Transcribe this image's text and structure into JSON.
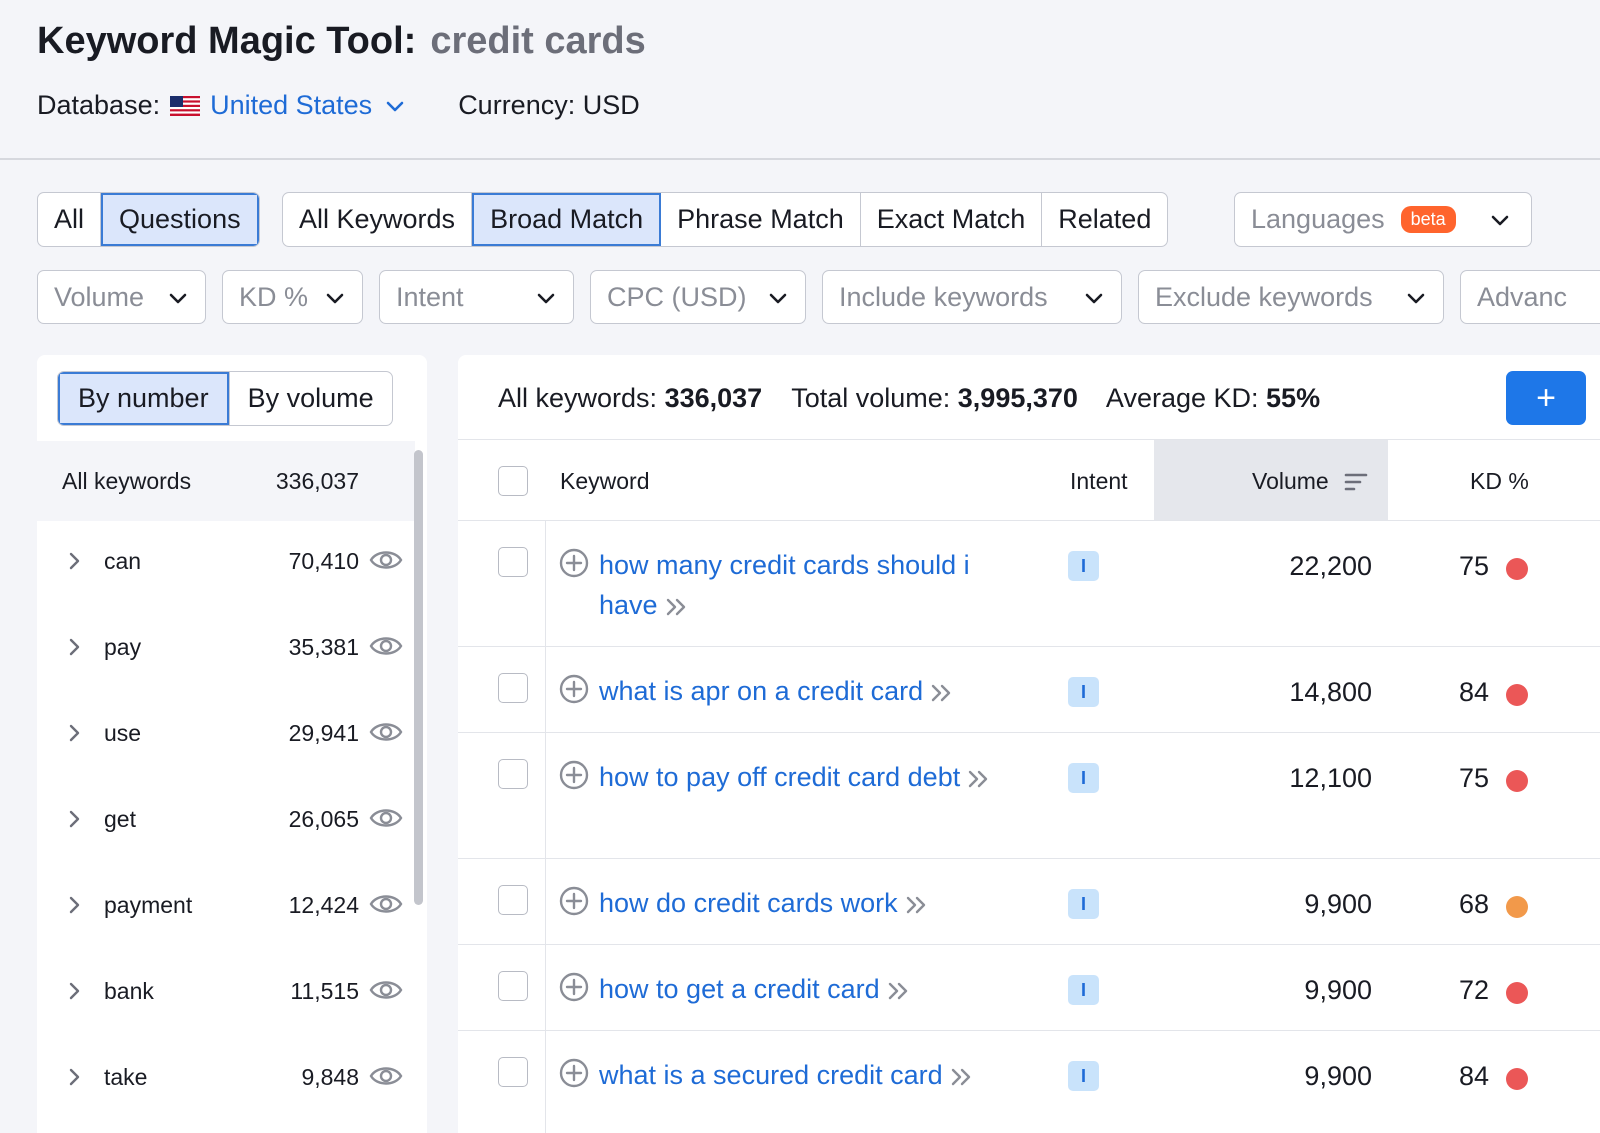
{
  "header": {
    "title": "Keyword Magic Tool:",
    "query": "credit cards",
    "database_label": "Database:",
    "database_value": "United States",
    "currency": "Currency: USD"
  },
  "tabs": {
    "group1": [
      {
        "label": "All",
        "active": false
      },
      {
        "label": "Questions",
        "active": true
      }
    ],
    "group2": [
      {
        "label": "All Keywords",
        "active": false
      },
      {
        "label": "Broad Match",
        "active": true
      },
      {
        "label": "Phrase Match",
        "active": false
      },
      {
        "label": "Exact Match",
        "active": false
      },
      {
        "label": "Related",
        "active": false
      }
    ],
    "languages": {
      "label": "Languages",
      "badge": "beta"
    }
  },
  "filters": [
    "Volume",
    "KD %",
    "Intent",
    "CPC (USD)",
    "Include keywords",
    "Exclude keywords",
    "Advanc"
  ],
  "groups_panel": {
    "toggle": [
      {
        "label": "By number",
        "active": true
      },
      {
        "label": "By volume",
        "active": false
      }
    ],
    "all_label": "All keywords",
    "all_count": "336,037",
    "items": [
      {
        "label": "can",
        "count": "70,410"
      },
      {
        "label": "pay",
        "count": "35,381"
      },
      {
        "label": "use",
        "count": "29,941"
      },
      {
        "label": "get",
        "count": "26,065"
      },
      {
        "label": "payment",
        "count": "12,424"
      },
      {
        "label": "bank",
        "count": "11,515"
      },
      {
        "label": "take",
        "count": "9,848"
      }
    ]
  },
  "summary": {
    "all_label": "All keywords:",
    "all_value": "336,037",
    "volume_label": "Total volume:",
    "volume_value": "3,995,370",
    "kd_label": "Average KD:",
    "kd_value": "55%",
    "add_button": "+"
  },
  "table": {
    "headers": {
      "keyword": "Keyword",
      "intent": "Intent",
      "volume": "Volume",
      "kd": "KD %"
    },
    "rows": [
      {
        "keyword": "how many credit cards should i have",
        "intent": "I",
        "volume": "22,200",
        "kd": "75",
        "kd_color": "#eb5757"
      },
      {
        "keyword": "what is apr on a credit card",
        "intent": "I",
        "volume": "14,800",
        "kd": "84",
        "kd_color": "#eb5757"
      },
      {
        "keyword": "how to pay off credit card debt",
        "intent": "I",
        "volume": "12,100",
        "kd": "75",
        "kd_color": "#eb5757"
      },
      {
        "keyword": "how do credit cards work",
        "intent": "I",
        "volume": "9,900",
        "kd": "68",
        "kd_color": "#f2994a"
      },
      {
        "keyword": "how to get a credit card",
        "intent": "I",
        "volume": "9,900",
        "kd": "72",
        "kd_color": "#eb5757"
      },
      {
        "keyword": "what is a secured credit card",
        "intent": "I",
        "volume": "9,900",
        "kd": "84",
        "kd_color": "#eb5757"
      }
    ]
  },
  "colors": {
    "accent": "#1e77e8",
    "link": "#1e6bd6",
    "kd_hard": "#eb5757",
    "kd_medium": "#f2994a"
  }
}
